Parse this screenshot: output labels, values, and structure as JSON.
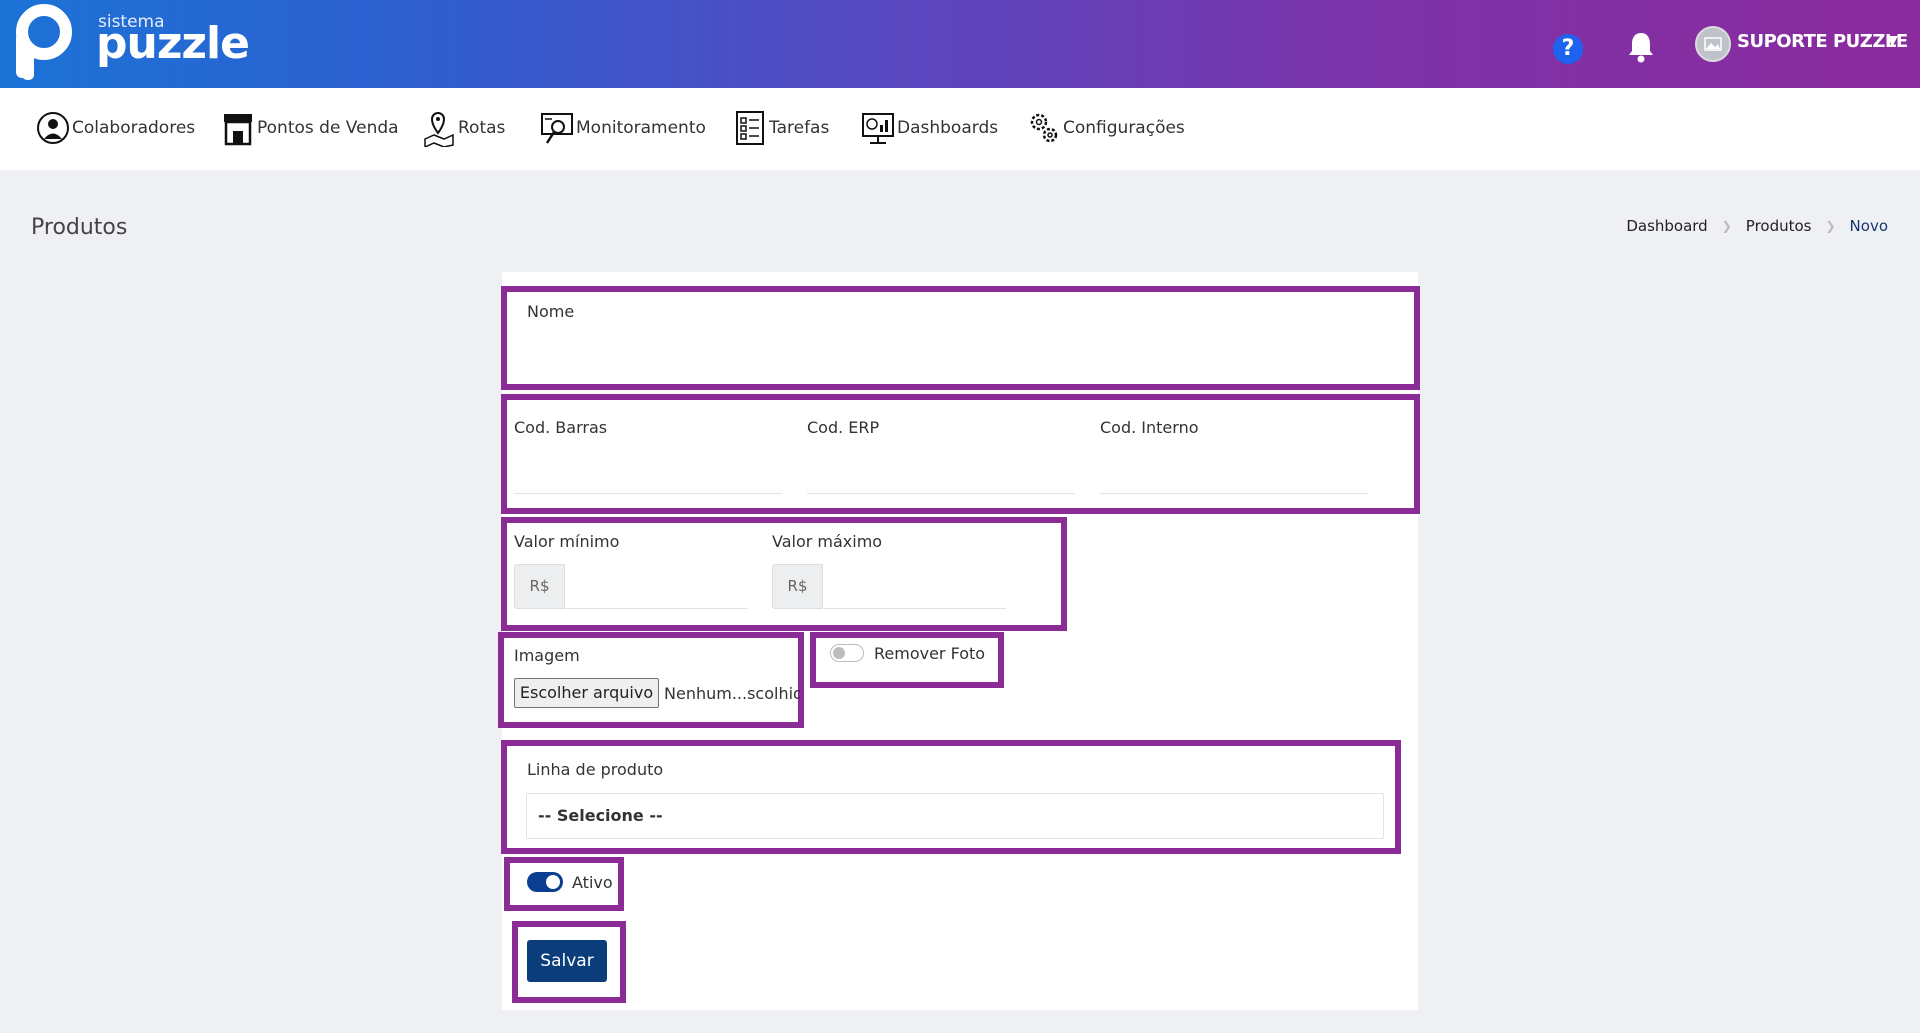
{
  "header": {
    "logo_small": "sistema",
    "logo_big": "puzzle",
    "help_icon": "question-circle-icon",
    "bell_icon": "bell-icon",
    "user_name": "SUPORTE PUZZLE",
    "user_caret": "⌄"
  },
  "nav": {
    "items": [
      {
        "label": "Colaboradores",
        "icon": "user-circle-icon"
      },
      {
        "label": "Pontos de Venda",
        "icon": "storefront-icon"
      },
      {
        "label": "Rotas",
        "icon": "map-pin-icon"
      },
      {
        "label": "Monitoramento",
        "icon": "monitor-search-icon"
      },
      {
        "label": "Tarefas",
        "icon": "checklist-icon"
      },
      {
        "label": "Dashboards",
        "icon": "dashboard-chart-icon"
      },
      {
        "label": "Configurações",
        "icon": "gears-icon"
      }
    ]
  },
  "page": {
    "title": "Produtos",
    "breadcrumb": [
      "Dashboard",
      "Produtos",
      "Novo"
    ]
  },
  "form": {
    "nome_label": "Nome",
    "nome_value": "",
    "cod_barras_label": "Cod. Barras",
    "cod_erp_label": "Cod. ERP",
    "cod_interno_label": "Cod. Interno",
    "valor_minimo_label": "Valor mínimo",
    "valor_maximo_label": "Valor máximo",
    "currency_prefix": "R$",
    "imagem_label": "Imagem",
    "file_button_label": "Escolher arquivo",
    "file_status": "Nenhum...scolhido",
    "remover_foto_label": "Remover Foto",
    "remover_foto_on": false,
    "linha_produto_label": "Linha de produto",
    "linha_produto_selected": "-- Selecione --",
    "ativo_label": "Ativo",
    "ativo_on": true,
    "save_label": "Salvar"
  },
  "colors": {
    "highlight_border": "#8a2b96",
    "save_button": "#0b3d7a",
    "toggle_on": "#0b3d91"
  }
}
